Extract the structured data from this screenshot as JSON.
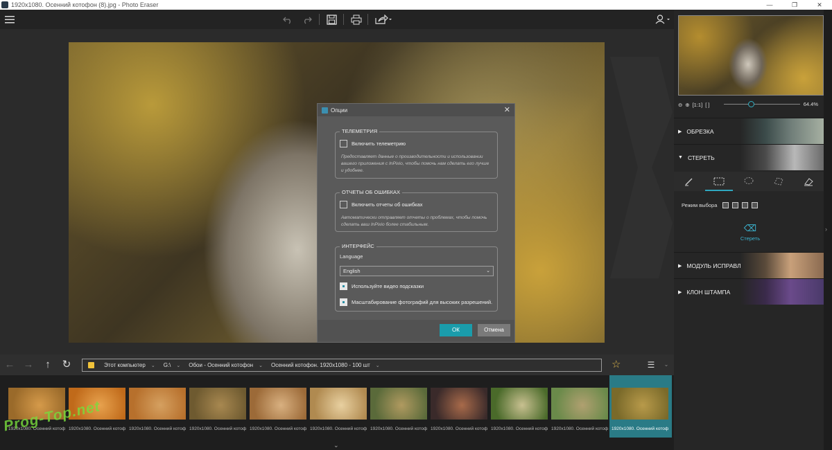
{
  "window": {
    "title": "1920x1080. Осенний котофон (8).jpg - Photo Eraser",
    "controls": [
      "—",
      "❐",
      "✕"
    ]
  },
  "toolbar": {
    "icons": [
      "menu-icon",
      "undo-icon",
      "redo-icon",
      "save-icon",
      "print-icon",
      "share-icon",
      "user-icon"
    ]
  },
  "dialog": {
    "title": "Опции",
    "telemetry": {
      "legend": "ТЕЛЕМЕТРИЯ",
      "checkbox_label": "Включить телеметрию",
      "checked": false,
      "description": "Предоставляет данные о производительности и использовании вашего приложения с InPixio, чтобы помочь нам сделать его лучше и удобнее."
    },
    "errors": {
      "legend": "ОТЧЕТЫ ОБ ОШИБКАХ",
      "checkbox_label": "Включить отчеты об ошибках",
      "checked": false,
      "description": "Автоматически отправляет отчеты о проблемах, чтобы помочь сделать ваш InPixio более стабильным."
    },
    "interface": {
      "legend": "ИНТЕРФЕЙС",
      "language_label": "Language",
      "language_value": "English",
      "video_hints_label": "Используйте видео подсказки",
      "video_hints_checked": true,
      "hidpi_label": "Масштабирование фотографий для высоких разрешений.",
      "hidpi_checked": true
    },
    "ok_label": "ОК",
    "cancel_label": "Отмена"
  },
  "navbar": {
    "breadcrumb": [
      "Этот компьютер",
      "G:\\",
      "Обои - Осенний котофон",
      "Осенний котофон. 1920x1080 - 100 шт"
    ]
  },
  "filmstrip": {
    "caption": "1920x1080. Осенний котоф",
    "selected_index": 10,
    "thumbs": [
      {
        "c1": "#9a6a2a",
        "c2": "#d59a4a"
      },
      {
        "c1": "#c06a1a",
        "c2": "#e7a24e"
      },
      {
        "c1": "#b7702c",
        "c2": "#d5a060"
      },
      {
        "c1": "#6e5a30",
        "c2": "#a88850"
      },
      {
        "c1": "#9c6a38",
        "c2": "#d8b080"
      },
      {
        "c1": "#b08a50",
        "c2": "#e8d0a0"
      },
      {
        "c1": "#5a6a3a",
        "c2": "#b09a60"
      },
      {
        "c1": "#3a2a2a",
        "c2": "#a86a4a"
      },
      {
        "c1": "#4a6a2a",
        "c2": "#c8c090"
      },
      {
        "c1": "#6a8a4a",
        "c2": "#b0a070"
      },
      {
        "c1": "#7a6a2a",
        "c2": "#b89a4a"
      }
    ],
    "watermark": "Prog-Top.net"
  },
  "right_panel": {
    "zoom_value": "64.4%",
    "sections": {
      "crop": "ОБРЕЗКА",
      "erase": "СТЕРЕТЬ",
      "repair": "МОДУЛЬ ИСПРАВЛЕНИЯ",
      "clone": "КЛОН ШТАМПА"
    },
    "mode_label": "Режим выбора",
    "erase_button": "Стереть"
  }
}
